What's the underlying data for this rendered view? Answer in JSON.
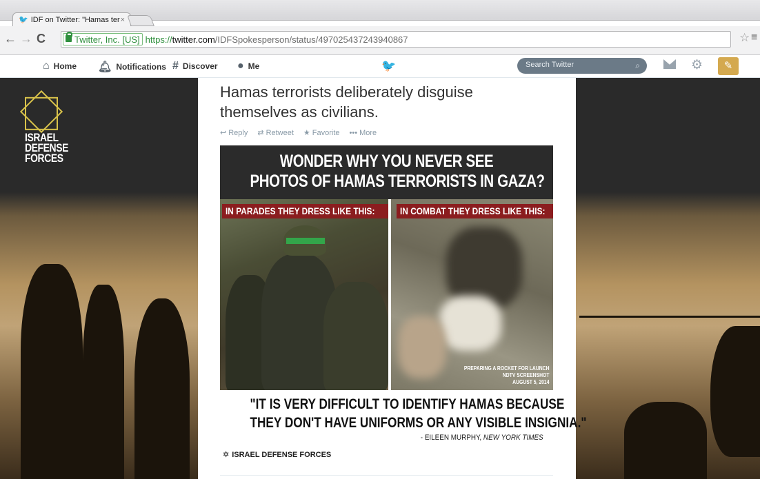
{
  "browser": {
    "tab_title": "IDF on Twitter: \"Hamas ter",
    "tab_close": "×",
    "ev_cert": "Twitter, Inc. [US]",
    "url_scheme": "https://",
    "url_host": "twitter.com",
    "url_path": "/IDFSpokesperson/status/497025437243940867"
  },
  "twitter_nav": {
    "items": [
      {
        "label": "Home",
        "icon": "home-icon"
      },
      {
        "label": "Notifications",
        "icon": "bell-icon"
      },
      {
        "label": "Discover",
        "icon": "hashtag-icon"
      },
      {
        "label": "Me",
        "icon": "user-icon"
      }
    ],
    "search_placeholder": "Search Twitter"
  },
  "profile_logo": {
    "line1": "ISRAEL",
    "line2": "DEFENSE",
    "line3": "FORCES"
  },
  "tweet": {
    "text": "Hamas terrorists deliberately disguise themselves as civilians.",
    "actions": {
      "reply": "Reply",
      "retweet": "Retweet",
      "favorite": "Favorite",
      "more": "More"
    }
  },
  "card": {
    "headline_line1": "WONDER WHY YOU NEVER SEE",
    "headline_line2": "PHOTOS OF HAMAS TERRORISTS IN GAZA?",
    "left_label": "IN PARADES THEY DRESS LIKE THIS:",
    "right_label": "IN COMBAT THEY DRESS LIKE THIS:",
    "caption_line1": "PREPARING A ROCKET FOR LAUNCH",
    "caption_line2": "NDTV SCREENSHOT",
    "caption_line3": "AUGUST 5, 2014",
    "quote_line1": "\"IT IS VERY DIFFICULT TO IDENTIFY HAMAS BECAUSE",
    "quote_line2": "THEY DON'T HAVE UNIFORMS OR ANY VISIBLE INSIGNIA.\"",
    "attribution_prefix": "- EILEEN MURPHY, ",
    "attribution_source": "NEW YORK TIMES",
    "footer_logo": "ISRAEL DEFENSE FORCES"
  }
}
